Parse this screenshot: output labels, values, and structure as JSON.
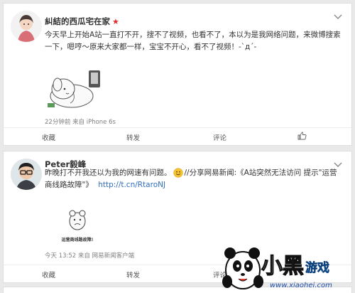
{
  "posts": [
    {
      "author": "糾結的西瓜宅在家",
      "text": "今天早上开始A站一直打不开，搜不了视频，也看不了，本以为是我网络问题，来微博搜索一下，嗯哼～原来大家都一样，宝宝不开心，看不了视频！-`д´-",
      "meta": "22分钟前 来自 iPhone 6s",
      "actions": {
        "collect": "收藏",
        "repost": "转发",
        "comment": "评论"
      }
    },
    {
      "author": "Peter毅峰",
      "text_part1": "昨晚打不开我还以为我的网速有问题。",
      "text_part2": "//分享网易新闻:《A站突然无法访问 提示\"运营商线路故障\"》",
      "link": "http://t.cn/RtaroNJ",
      "image_caption": "运营商线路故障!",
      "meta": "今天 13:52 来自 网易新闻客户端",
      "actions": {
        "collect": "收藏",
        "repost": "转发",
        "comment": "评论"
      }
    }
  ],
  "watermark": {
    "brand": "小黑游戏",
    "url": "www.xiaohei.com"
  },
  "colors": {
    "star": "#e02b2b",
    "link": "#2f6fbf",
    "meta": "#808080"
  }
}
